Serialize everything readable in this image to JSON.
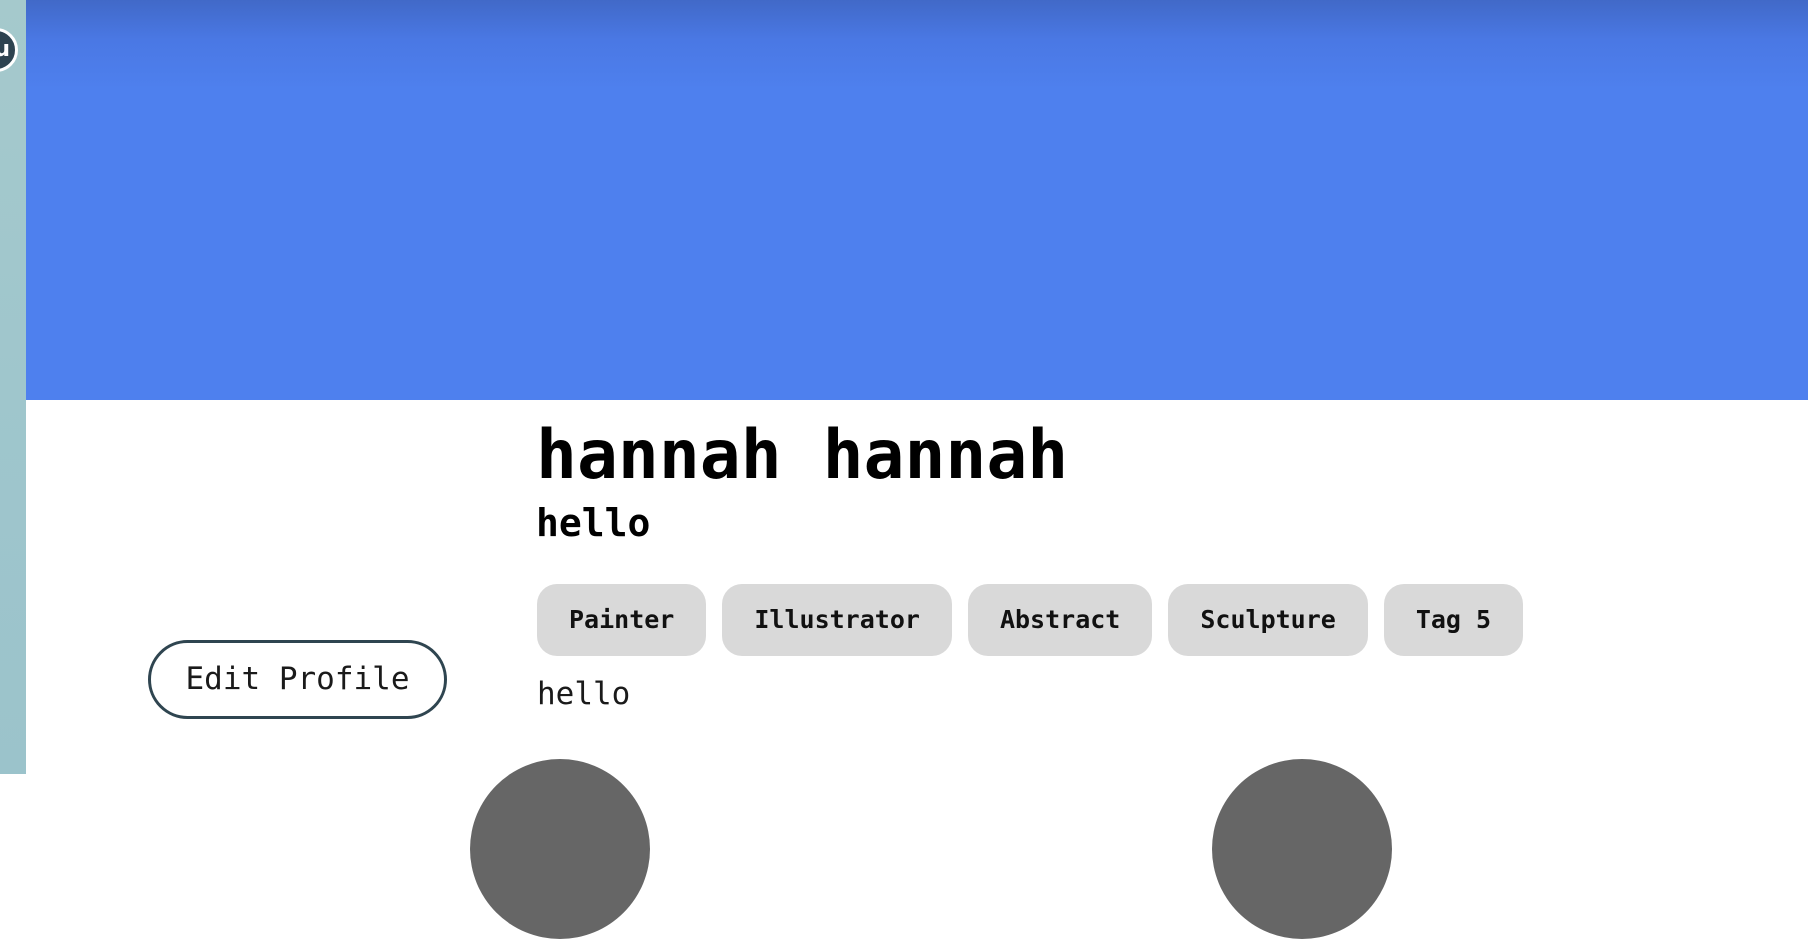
{
  "sidebar": {
    "logo_glyph": "u"
  },
  "banner": {
    "color": "#4e80ee"
  },
  "profile": {
    "name": "hannah hannah",
    "subtitle": "hello",
    "tags": [
      "Painter",
      "Illustrator",
      "Abstract",
      "Sculpture",
      "Tag 5"
    ],
    "bio": "hello",
    "edit_button_label": "Edit Profile"
  },
  "colors": {
    "sidebar": "#a0c6cc",
    "tag_bg": "#d9d9d9",
    "button_border": "#2f4550",
    "avatar_placeholder": "#666666"
  }
}
